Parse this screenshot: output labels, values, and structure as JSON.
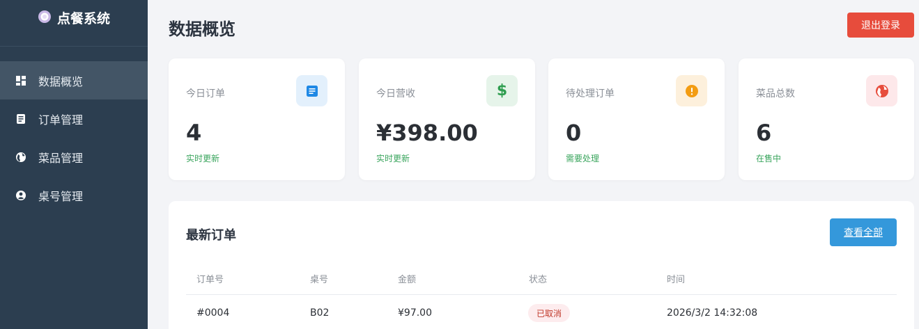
{
  "brand": {
    "title": "点餐系统",
    "icon": "plate-icon"
  },
  "sidebar": {
    "items": [
      {
        "label": "数据概览",
        "icon": "dashboard-icon",
        "active": true
      },
      {
        "label": "订单管理",
        "icon": "receipt-icon",
        "active": false
      },
      {
        "label": "菜品管理",
        "icon": "globe-icon",
        "active": false
      },
      {
        "label": "桌号管理",
        "icon": "user-circle-icon",
        "active": false
      }
    ]
  },
  "header": {
    "title": "数据概览",
    "logout_label": "退出登录"
  },
  "stats": [
    {
      "label": "今日订单",
      "value": "4",
      "note": "实时更新",
      "icon": "document-icon",
      "icon_color": "#1e88e5",
      "icon_bg": "#e3f0fc"
    },
    {
      "label": "今日营收",
      "value": "¥398.00",
      "note": "实时更新",
      "icon": "dollar-icon",
      "icon_color": "#2e9d4f",
      "icon_bg": "#e6f4ea"
    },
    {
      "label": "待处理订单",
      "value": "0",
      "note": "需要处理",
      "icon": "alert-icon",
      "icon_color": "#f39c12",
      "icon_bg": "#fdf0dc"
    },
    {
      "label": "菜品总数",
      "value": "6",
      "note": "在售中",
      "icon": "globe-icon",
      "icon_color": "#e74c3c",
      "icon_bg": "#fde8ea"
    }
  ],
  "orders": {
    "title": "最新订单",
    "view_all_label": "查看全部",
    "columns": [
      "订单号",
      "桌号",
      "金额",
      "状态",
      "时间"
    ],
    "rows": [
      {
        "order_no": "#0004",
        "table": "B02",
        "amount": "¥97.00",
        "status": "已取消",
        "time": "2026/3/2 14:32:08"
      }
    ]
  },
  "colors": {
    "sidebar": "#2c3e50",
    "sidebar_active": "#435566",
    "danger": "#e74c3c",
    "primary": "#3498db",
    "success": "#3aa55d"
  }
}
